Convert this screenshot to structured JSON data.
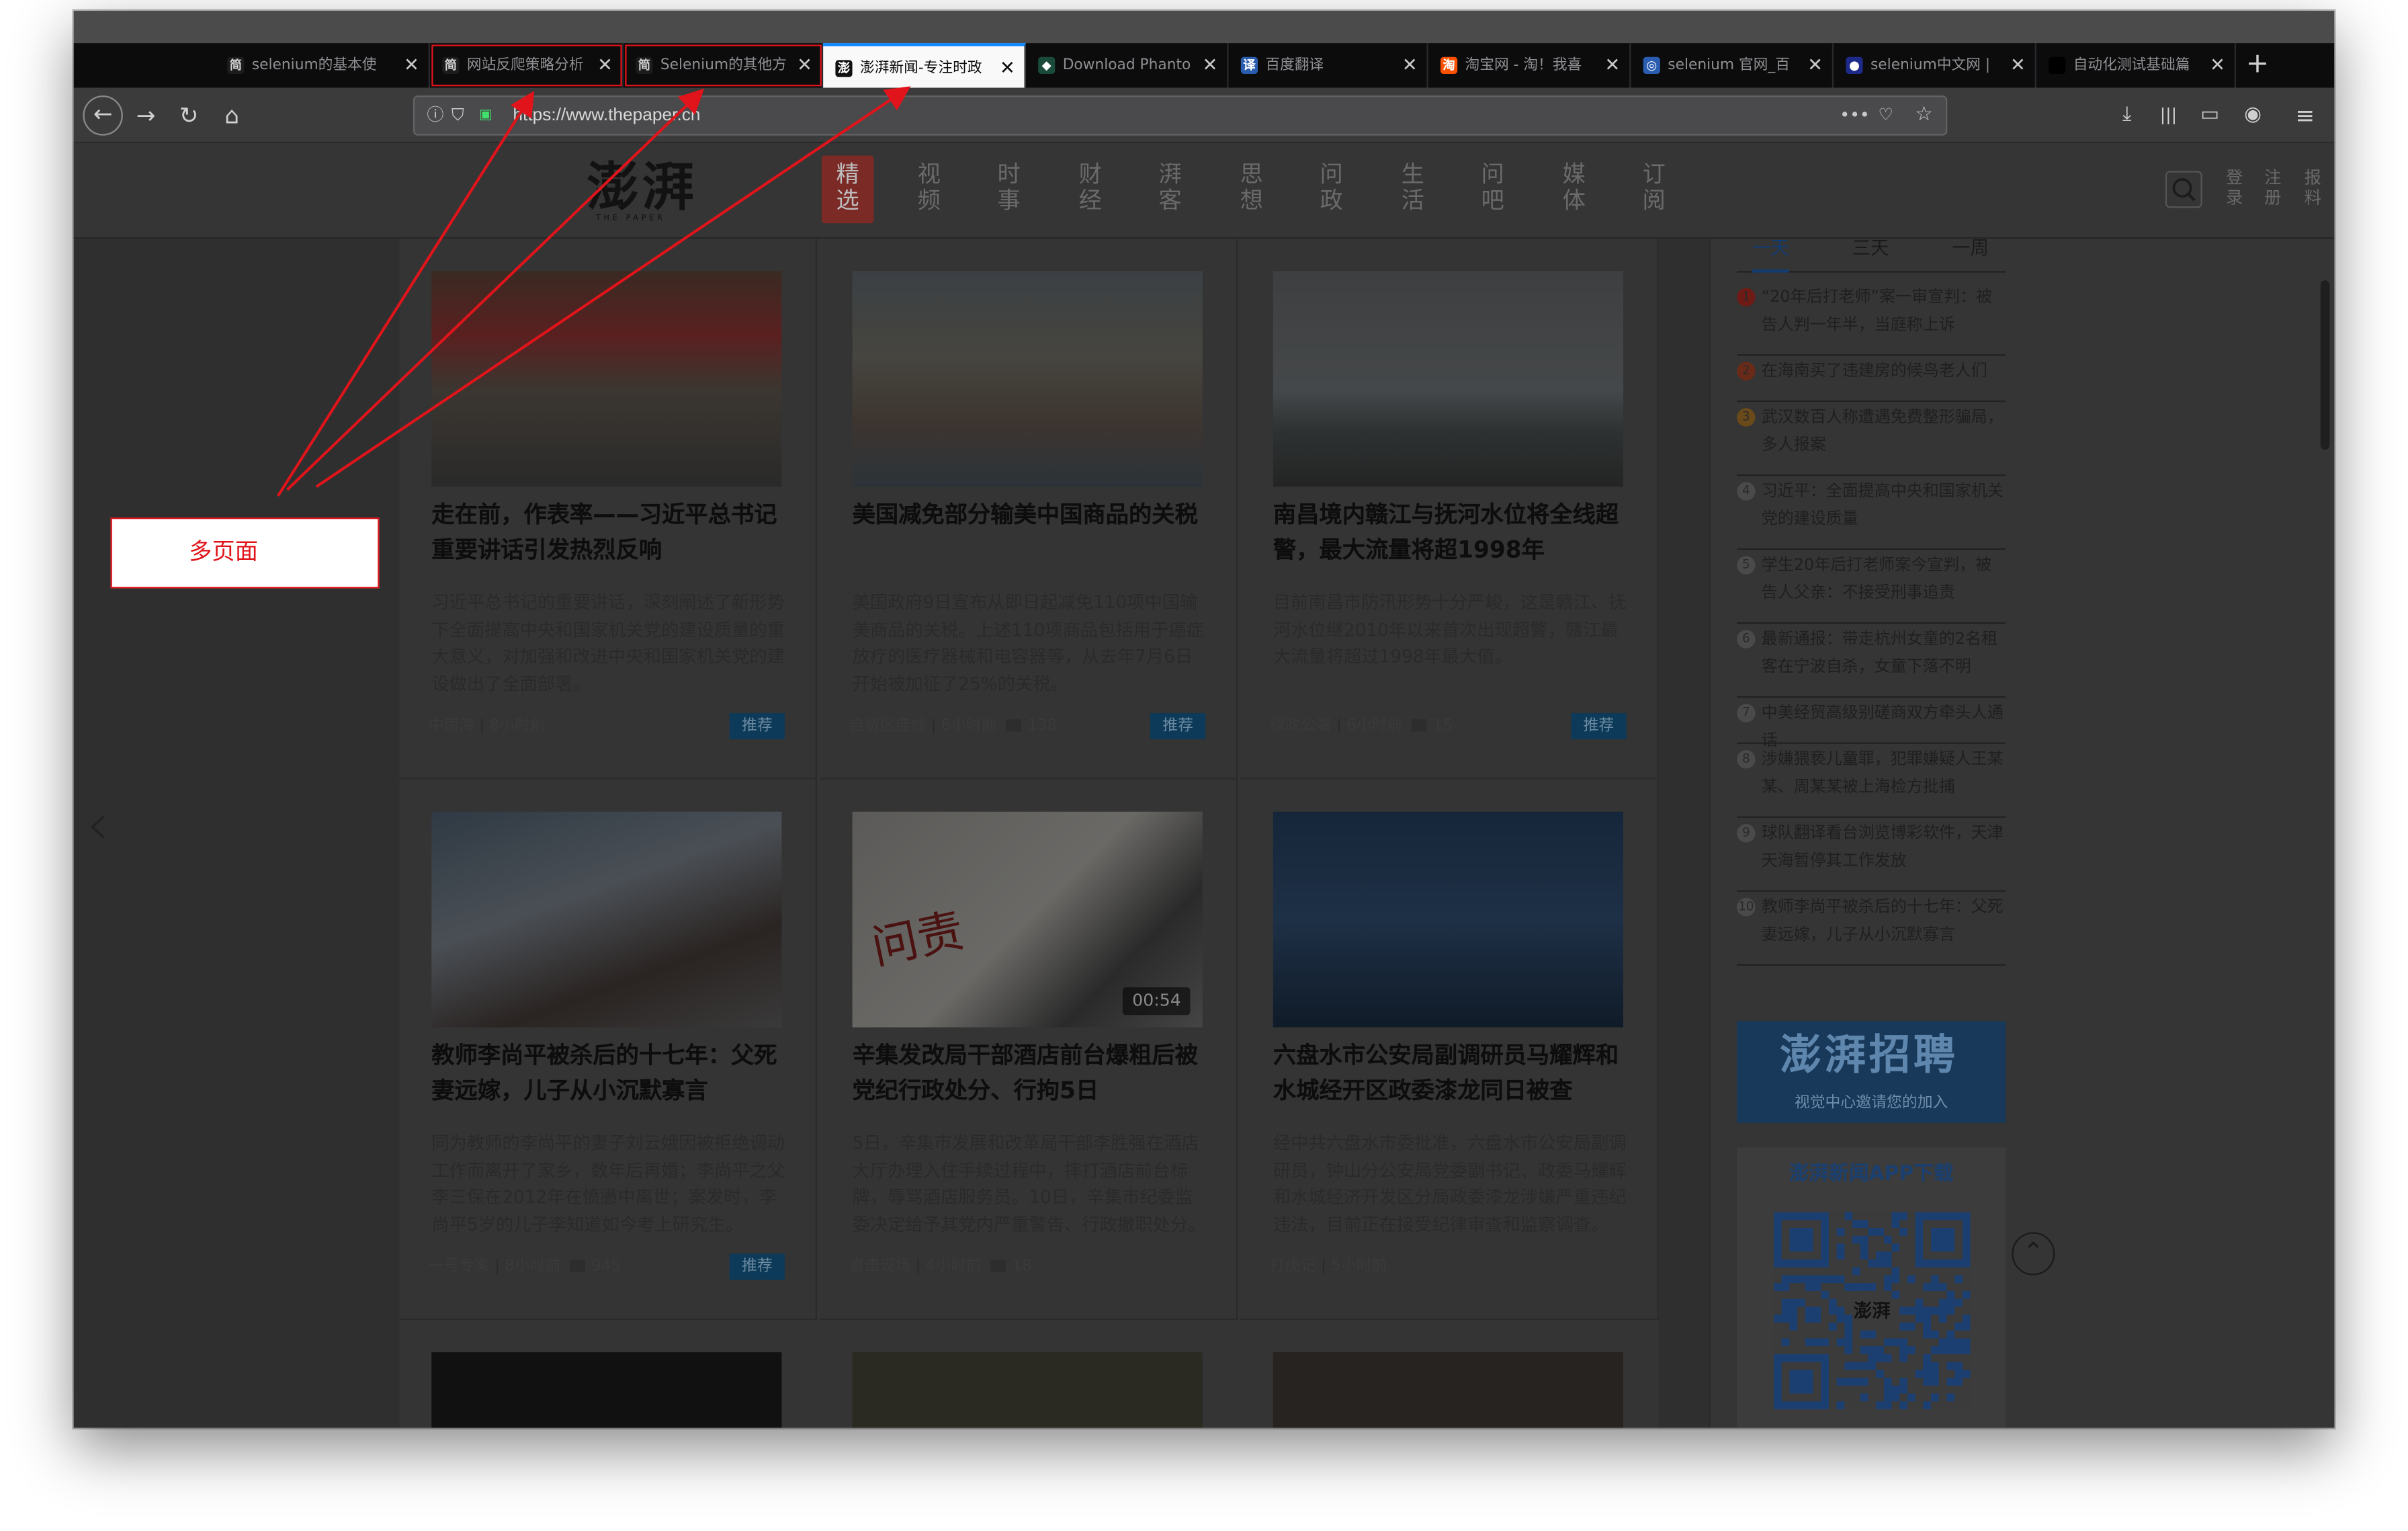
{
  "browser": {
    "tabs": [
      {
        "label": "selenium的基本使",
        "favicon": "简",
        "favicon_color": "#222222"
      },
      {
        "label": "网站反爬策略分析",
        "favicon": "简",
        "favicon_color": "#222222",
        "highlighted": true
      },
      {
        "label": "Selenium的其他方",
        "favicon": "简",
        "favicon_color": "#222222",
        "highlighted": true
      },
      {
        "label": "澎湃新闻-专注时政",
        "favicon": "澎",
        "favicon_color": "#ffffff",
        "active": true
      },
      {
        "label": "Download Phanto",
        "favicon": "◆",
        "favicon_color": "#1a4a3a"
      },
      {
        "label": "百度翻译",
        "favicon": "译",
        "favicon_color": "#2a5db0"
      },
      {
        "label": "淘宝网 - 淘！我喜",
        "favicon": "淘",
        "favicon_color": "#ff5000"
      },
      {
        "label": "selenium 官网_百",
        "favicon": "◎",
        "favicon_color": "#2a5db0"
      },
      {
        "label": "selenium中文网 |",
        "favicon": "●",
        "favicon_color": "#1e2a8a"
      },
      {
        "label": "自动化测试基础篇",
        "favicon": "",
        "favicon_color": "#000000"
      }
    ],
    "close_glyph": "✕",
    "new_tab_glyph": "+",
    "url": "https://www.thepaper.cn",
    "icons": {
      "back": "←",
      "forward": "→",
      "reload": "↻",
      "home": "⌂",
      "info": "ⓘ",
      "shield": "⛉",
      "lock": "🔒",
      "more": "•••",
      "pocket": "♡",
      "star": "☆",
      "download": "⤓",
      "library": "|||",
      "sidebar": "▭",
      "account": "◉",
      "menu": "≡"
    }
  },
  "site": {
    "logo": "澎湃",
    "logo_sub": "THE PAPER",
    "nav": [
      "精选",
      "视频",
      "时事",
      "财经",
      "澎湃号",
      "思想",
      "问政",
      "生活",
      "问吧",
      "媒体",
      "订阅"
    ],
    "nav_display": [
      "精\n选",
      "视\n频",
      "时\n事",
      "财\n经",
      "湃\n客",
      "思\n想",
      "问\n政",
      "生\n活",
      "问\n吧",
      "媒\n体",
      "订\n阅"
    ],
    "header_links": [
      "登录",
      "注册",
      "报料"
    ],
    "search_icon": "search-icon"
  },
  "articles": [
    {
      "title": "走在前，作表率——习近平总书记重要讲话引发热烈反响",
      "summary": "习近平总书记的重要讲话，深刻阐述了新形势下全面提高中央和国家机关党的建设质量的重大意义，对加强和改进中央和国家机关党的建设做出了全面部署。",
      "source": "中南海",
      "time": "8小时前",
      "comments": "",
      "badge": "推荐"
    },
    {
      "title": "美国减免部分输美中国商品的关税",
      "summary": "美国政府9日宣布从即日起减免110项中国输美商品的关税。上述110项商品包括用于癌症放疗的医疗器械和电容器等，从去年7月6日开始被加征了25%的关税。",
      "source": "自贸区连线",
      "time": "6小时前",
      "comments": "138",
      "badge": "推荐"
    },
    {
      "title": "南昌境内赣江与抚河水位将全线超警，最大流量将超1998年",
      "summary": "目前南昌市防汛形势十分严峻，这是赣江、抚河水位继2010年以来首次出现超警，赣江最大流量将超过1998年最大值。",
      "source": "绿政公署",
      "time": "6小时前",
      "comments": "15",
      "badge": "推荐"
    },
    {
      "title": "教师李尚平被杀后的十七年：父死妻远嫁，儿子从小沉默寡言",
      "summary": "同为教师的李尚平的妻子刘云娥因被拒绝调动工作而离开了家乡，数年后再婚；李尚平之父李三保在2012年在愤懑中离世；案发时，李尚平5岁的儿子李知道如今考上研究生。",
      "source": "一号专案",
      "time": "8小时前",
      "comments": "945",
      "badge": "推荐"
    },
    {
      "title": "辛集发改局干部酒店前台爆粗后被党纪行政处分、行拘5日",
      "summary": "5日，辛集市发展和改革局干部李胜强在酒店大厅办理入住手续过程中，摔打酒店前台标牌，辱骂酒店服务员。10日，辛集市纪委监委决定给予其党内严重警告、行政撤职处分。",
      "source": "直击现场",
      "time": "4小时前",
      "comments": "18",
      "badge": "",
      "video_duration": "00:54",
      "image_text": "问责"
    },
    {
      "title": "六盘水市公安局副调研员马耀辉和水城经开区政委漆龙同日被查",
      "summary": "经中共六盘水市委批准，六盘水市公安局副调研员，钟山分公安局党委副书记、政委马耀辉和水城经济开发区分局政委漆龙涉嫌严重违纪违法，目前正在接受纪律审查和监察调查。",
      "source": "打虎记",
      "time": "5小时前",
      "comments": "",
      "badge": ""
    }
  ],
  "ranking": {
    "tabs": [
      "一天",
      "三天",
      "一周"
    ],
    "items": [
      "“20年后打老师”案一审宣判：被告人判一年半，当庭称上诉",
      "在海南买了违建房的候鸟老人们",
      "武汉数百人称遭遇免费整形骗局，多人报案",
      "习近平：全面提高中央和国家机关党的建设质量",
      "学生20年后打老师案今宣判，被告人父亲：不接受刑事追责",
      "最新通报：带走杭州女童的2名租客在宁波自杀，女童下落不明",
      "中美经贸高级别磋商双方牵头人通话",
      "涉嫌猥亵儿童罪，犯罪嫌疑人王某某、周某某被上海检方批捕",
      "球队翻译看台浏览博彩软件，天津天海暂停其工作发放",
      "教师李尚平被杀后的十七年：父死妻远嫁，儿子从小沉默寡言"
    ]
  },
  "recruit": {
    "title": "澎湃招聘",
    "subtitle": "视觉中心邀请您的加入"
  },
  "app_download": {
    "title": "澎湃新闻APP下载",
    "qr_center": "澎湃"
  },
  "annotation": {
    "label": "多页面",
    "color": "#e0141a"
  },
  "colors": {
    "accent_red": "#e0141a",
    "firefox_blue": "#0a84ff",
    "badge_blue": "#0d3a58"
  }
}
